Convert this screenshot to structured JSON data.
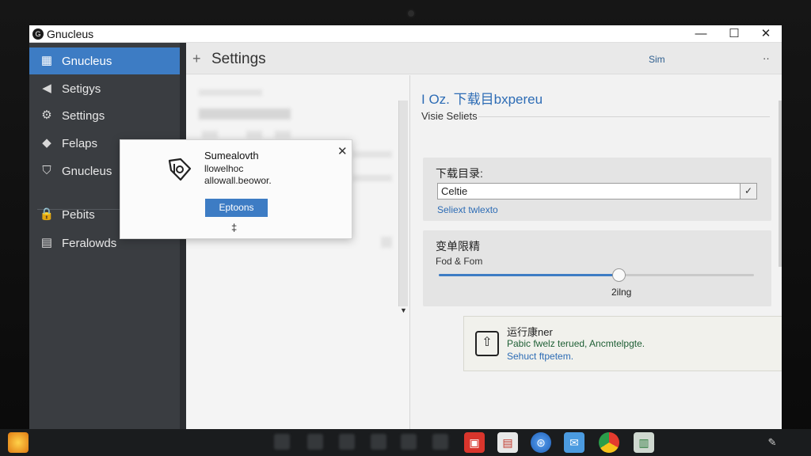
{
  "window": {
    "title": "Gnucleus",
    "minimize": "—",
    "maximize": "☐",
    "close": "✕"
  },
  "sidebar": {
    "items": [
      {
        "label": "Gnucleus",
        "icon": "grid-icon",
        "glyph": "▦"
      },
      {
        "label": "Setigys",
        "icon": "speaker-icon",
        "glyph": "◀"
      },
      {
        "label": "Settings",
        "icon": "sliders-icon",
        "glyph": "⚙"
      },
      {
        "label": "Felaps",
        "icon": "tag-icon",
        "glyph": "◆"
      },
      {
        "label": "Gnucleus",
        "icon": "shield-icon",
        "glyph": "⛉"
      },
      {
        "label": "Pebits",
        "icon": "lock-icon",
        "glyph": "🔒"
      },
      {
        "label": "Feralowds",
        "icon": "document-icon",
        "glyph": "▤"
      }
    ]
  },
  "header": {
    "plus": "+",
    "title": "Settings",
    "right_text": "Sim",
    "more": "··"
  },
  "right": {
    "heading": "I Oz. 下载目bxpereu",
    "subheading": "Visie Seliets",
    "download_card": {
      "label": "下载目录:",
      "input_value": "Celtie",
      "check": "✓",
      "link": "Seliext twlexto"
    },
    "speed_card": {
      "title": "变单限精",
      "subtitle": "Fod & Fom",
      "slider_value": "2ilng",
      "slider_fraction": 0.57
    },
    "info_card": {
      "title": "运行康ner",
      "desc": "Pabic fwelz terued, Ancmtelpgte.",
      "link": "Sehuct ftpetem."
    }
  },
  "dialog": {
    "title": "Sumealovth",
    "line1": "llowelhoc",
    "line2": "allowall.beowor.",
    "button": "Eptoons",
    "close": "✕",
    "pin": "‡"
  },
  "colors": {
    "accent": "#3d7cc4",
    "sidebar_bg": "#3a3d41",
    "link": "#2d6cb5"
  }
}
